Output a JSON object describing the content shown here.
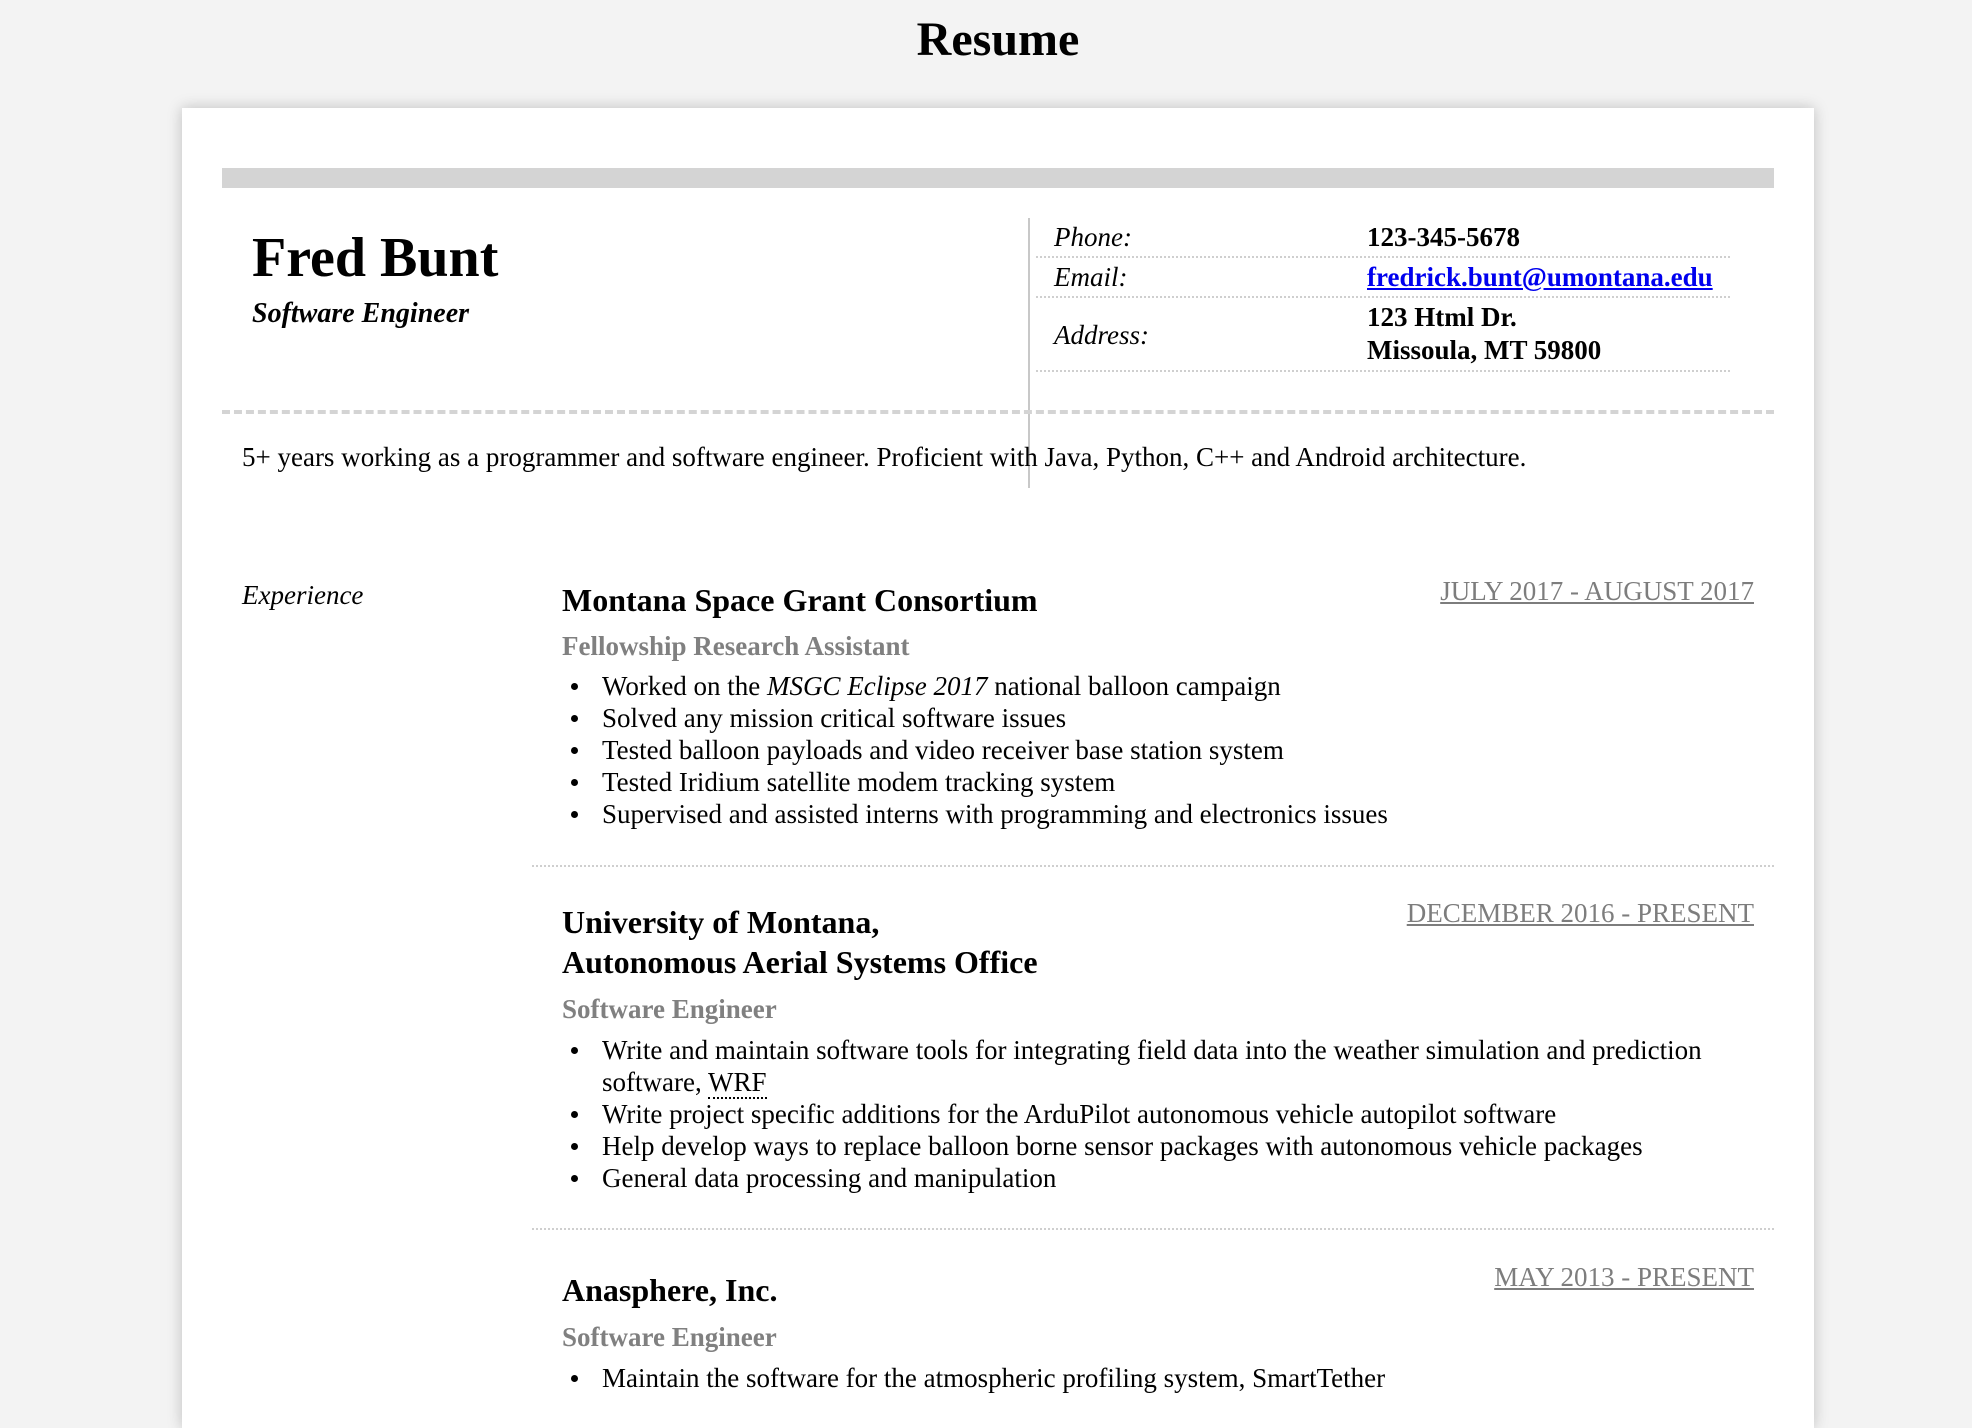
{
  "page": {
    "title": "Resume"
  },
  "header": {
    "name": "Fred Bunt",
    "job_title": "Software Engineer"
  },
  "contact": {
    "phone_label": "Phone:",
    "phone": "123-345-5678",
    "email_label": "Email:",
    "email": "fredrick.bunt@umontana.edu",
    "address_label": "Address:",
    "address_line1": "123 Html Dr.",
    "address_line2": "Missoula, MT 59800"
  },
  "summary": "5+ years working as a programmer and software engineer. Proficient with Java, Python, C++ and Android architecture.",
  "experience": {
    "label": "Experience",
    "jobs": [
      {
        "company": "Montana Space Grant Consortium",
        "date": "JULY 2017 - AUGUST 2017",
        "role": "Fellowship Research Assistant",
        "bullet1_pre": "Worked on the ",
        "bullet1_em": "MSGC Eclipse 2017",
        "bullet1_post": " national balloon campaign",
        "bullets": [
          "Solved any mission critical software issues",
          "Tested balloon payloads and video receiver base station system",
          "Tested Iridium satellite modem tracking system",
          "Supervised and assisted interns with programming and electronics issues"
        ]
      },
      {
        "company_line1": "University of Montana,",
        "company_line2": "Autonomous Aerial Systems Office",
        "date": "DECEMBER 2016 - PRESENT",
        "role": "Software Engineer",
        "bullet1_pre": "Write and maintain software tools for integrating field data into the weather simulation and prediction software, ",
        "bullet1_abbr": "WRF",
        "bullets": [
          "Write project specific additions for the ArduPilot autonomous vehicle autopilot software",
          "Help develop ways to replace balloon borne sensor packages with autonomous vehicle packages",
          "General data processing and manipulation"
        ]
      },
      {
        "company": "Anasphere, Inc.",
        "date": "MAY 2013 - PRESENT",
        "role": "Software Engineer",
        "bullets": [
          "Maintain the software for the atmospheric profiling system, SmartTether"
        ]
      }
    ]
  }
}
